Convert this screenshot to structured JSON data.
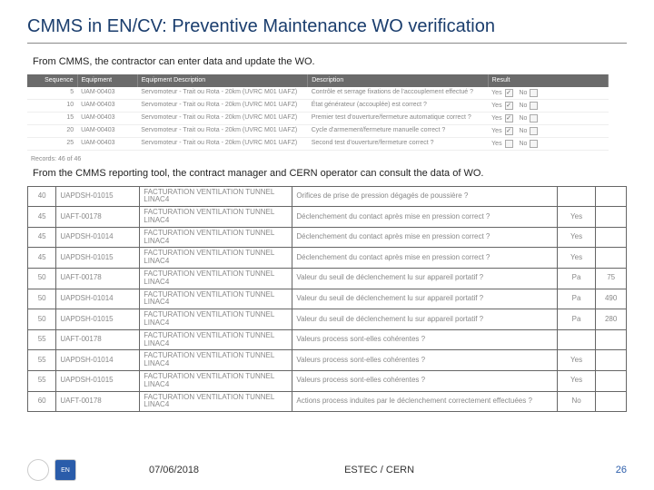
{
  "title": "CMMS in EN/CV: Preventive Maintenance WO verification",
  "intro1": "From CMMS, the contractor can enter data and update the WO.",
  "intro2": "From the CMMS reporting tool, the contract manager and CERN operator can consult the data of WO.",
  "t1_headers": {
    "seq": "Sequence",
    "eq": "Equipment",
    "eqd": "Equipment Description",
    "descr": "Description",
    "res": "Result"
  },
  "t1_rows": [
    {
      "seq": "5",
      "eq": "UAM-00403",
      "eqd": "Servomoteur - Trait ou Rota - 20km (UVRC M01 UAFZ)",
      "descr": "Contrôle et serrage fixations de l'accouplement effectué ?"
    },
    {
      "seq": "10",
      "eq": "UAM-00403",
      "eqd": "Servomoteur - Trait ou Rota - 20km (UVRC M01 UAFZ)",
      "descr": "État générateur (accouplée) est correct ?"
    },
    {
      "seq": "15",
      "eq": "UAM-00403",
      "eqd": "Servomoteur - Trait ou Rota - 20km (UVRC M01 UAFZ)",
      "descr": "Premier test d'ouverture/fermeture automatique correct ?"
    },
    {
      "seq": "20",
      "eq": "UAM-00403",
      "eqd": "Servomoteur - Trait ou Rota - 20km (UVRC M01 UAFZ)",
      "descr": "Cycle d'armement/fermeture manuelle correct ?"
    },
    {
      "seq": "25",
      "eq": "UAM-00403",
      "eqd": "Servomoteur - Trait ou Rota - 20km (UVRC M01 UAFZ)",
      "descr": "Second test d'ouverture/fermeture correct ?"
    }
  ],
  "yes": "Yes",
  "no": "No",
  "records": "Records: 46 of 46",
  "t2_rows": [
    {
      "c1": "40",
      "c2": "UAPDSH-01015",
      "c3": "FACTURATION VENTILATION TUNNEL LINAC4",
      "c4": "Orifices de prise de pression dégagés de poussière ?",
      "c5": "",
      "c6": ""
    },
    {
      "c1": "45",
      "c2": "UAFT-00178",
      "c3": "FACTURATION VENTILATION TUNNEL LINAC4",
      "c4": "Déclenchement du contact après mise en pression correct ?",
      "c5": "Yes",
      "c6": ""
    },
    {
      "c1": "45",
      "c2": "UAPDSH-01014",
      "c3": "FACTURATION VENTILATION TUNNEL LINAC4",
      "c4": "Déclenchement du contact après mise en pression correct ?",
      "c5": "Yes",
      "c6": ""
    },
    {
      "c1": "45",
      "c2": "UAPDSH-01015",
      "c3": "FACTURATION VENTILATION TUNNEL LINAC4",
      "c4": "Déclenchement du contact après mise en pression correct ?",
      "c5": "Yes",
      "c6": ""
    },
    {
      "c1": "50",
      "c2": "UAFT-00178",
      "c3": "FACTURATION VENTILATION TUNNEL LINAC4",
      "c4": "Valeur du seuil de déclenchement lu sur appareil portatif ?",
      "c5": "Pa",
      "c6": "75"
    },
    {
      "c1": "50",
      "c2": "UAPDSH-01014",
      "c3": "FACTURATION VENTILATION TUNNEL LINAC4",
      "c4": "Valeur du seuil de déclenchement lu sur appareil portatif ?",
      "c5": "Pa",
      "c6": "490"
    },
    {
      "c1": "50",
      "c2": "UAPDSH-01015",
      "c3": "FACTURATION VENTILATION TUNNEL LINAC4",
      "c4": "Valeur du seuil de déclenchement lu sur appareil portatif ?",
      "c5": "Pa",
      "c6": "280"
    },
    {
      "c1": "55",
      "c2": "UAFT-00178",
      "c3": "FACTURATION VENTILATION TUNNEL LINAC4",
      "c4": "Valeurs process sont-elles cohérentes ?",
      "c5": "",
      "c6": ""
    },
    {
      "c1": "55",
      "c2": "UAPDSH-01014",
      "c3": "FACTURATION VENTILATION TUNNEL LINAC4",
      "c4": "Valeurs process sont-elles cohérentes ?",
      "c5": "Yes",
      "c6": ""
    },
    {
      "c1": "55",
      "c2": "UAPDSH-01015",
      "c3": "FACTURATION VENTILATION TUNNEL LINAC4",
      "c4": "Valeurs process sont-elles cohérentes ?",
      "c5": "Yes",
      "c6": ""
    },
    {
      "c1": "60",
      "c2": "UAFT-00178",
      "c3": "FACTURATION VENTILATION TUNNEL LINAC4",
      "c4": "Actions process induites par le déclenchement correctement effectuées ?",
      "c5": "No",
      "c6": ""
    }
  ],
  "footer": {
    "logo1": "",
    "logo2": "EN",
    "date": "07/06/2018",
    "venue": "ESTEC / CERN",
    "page": "26"
  }
}
